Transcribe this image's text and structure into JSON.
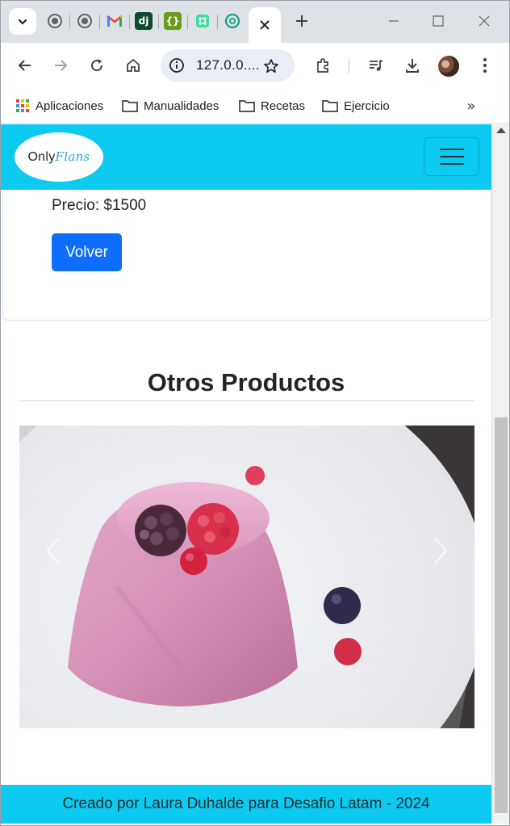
{
  "browser": {
    "address": "127.0.0....",
    "icons": [
      "tab-search-icon",
      "github-icon",
      "github-icon",
      "gmail-icon",
      "django-icon",
      "json-icon",
      "grid-icon",
      "chatgpt-icon",
      "close-icon",
      "plus-icon",
      "back-icon",
      "forward-icon",
      "reload-icon",
      "home-icon",
      "info-icon",
      "star-icon",
      "extensions-icon",
      "media-icon",
      "download-icon",
      "menu-icon"
    ],
    "tab_labels": {
      "django": "dj",
      "json": "{}"
    },
    "bookmarks": [
      {
        "label": "Aplicaciones",
        "icon": "apps-grid-icon"
      },
      {
        "label": "Manualidades",
        "icon": "folder-icon"
      },
      {
        "label": "Recetas",
        "icon": "folder-icon"
      },
      {
        "label": "Ejercicio",
        "icon": "folder-icon"
      }
    ],
    "bookmarks_more": "»"
  },
  "site": {
    "logo": {
      "part1": "Only",
      "part2": "Flans"
    },
    "accent_color": "#0dcaf0",
    "primary_color": "#0d6efd",
    "product": {
      "price": "Precio: $1500",
      "back_button": "Volver"
    },
    "other_products": {
      "title": "Otros Productos",
      "carousel_image": "pink panna cotta with berries on white plate"
    },
    "footer": "Creado por Laura Duhalde para Desafio Latam - 2024"
  }
}
